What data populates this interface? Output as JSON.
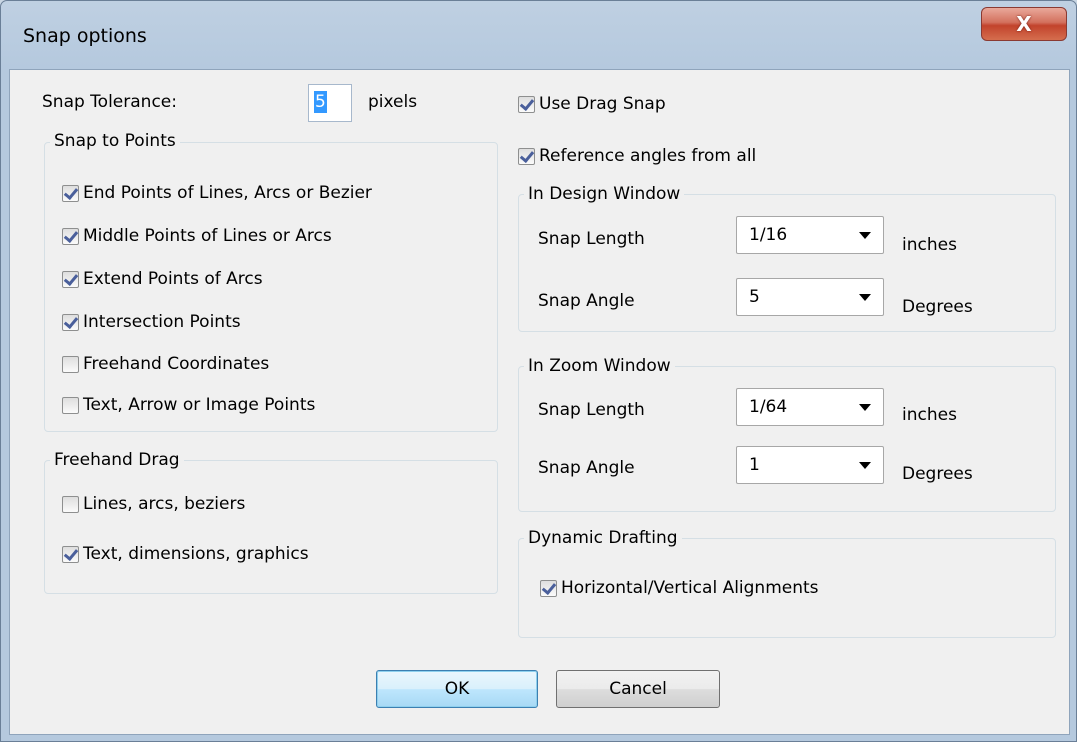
{
  "window": {
    "title": "Snap options",
    "close_label": "X"
  },
  "tolerance": {
    "label": "Snap Tolerance:",
    "value": "5",
    "unit": "pixels"
  },
  "snap_points": {
    "title": "Snap to Points",
    "items": [
      {
        "label": "End Points of Lines, Arcs or Bezier",
        "checked": true
      },
      {
        "label": "Middle Points of Lines or Arcs",
        "checked": true
      },
      {
        "label": "Extend Points of Arcs",
        "checked": true
      },
      {
        "label": "Intersection Points",
        "checked": true
      },
      {
        "label": "Freehand Coordinates",
        "checked": false
      },
      {
        "label": "Text, Arrow or Image Points",
        "checked": false
      }
    ]
  },
  "freehand_drag": {
    "title": "Freehand Drag",
    "items": [
      {
        "label": "Lines, arcs, beziers",
        "checked": false
      },
      {
        "label": "Text, dimensions, graphics",
        "checked": true
      }
    ]
  },
  "drag": {
    "use_drag_snap": {
      "label": "Use Drag Snap",
      "checked": true
    },
    "reference_angles": {
      "label": "Reference angles from all",
      "checked": true
    }
  },
  "design_window": {
    "title": "In Design Window",
    "length_label": "Snap Length",
    "length_value": "1/16",
    "length_unit": "inches",
    "angle_label": "Snap Angle",
    "angle_value": "5",
    "angle_unit": "Degrees"
  },
  "zoom_window": {
    "title": "In Zoom Window",
    "length_label": "Snap Length",
    "length_value": "1/64",
    "length_unit": "inches",
    "angle_label": "Snap Angle",
    "angle_value": "1",
    "angle_unit": "Degrees"
  },
  "dynamic_drafting": {
    "title": "Dynamic Drafting",
    "alignment": {
      "label": "Horizontal/Vertical Alignments",
      "checked": true
    }
  },
  "buttons": {
    "ok": "OK",
    "cancel": "Cancel"
  }
}
